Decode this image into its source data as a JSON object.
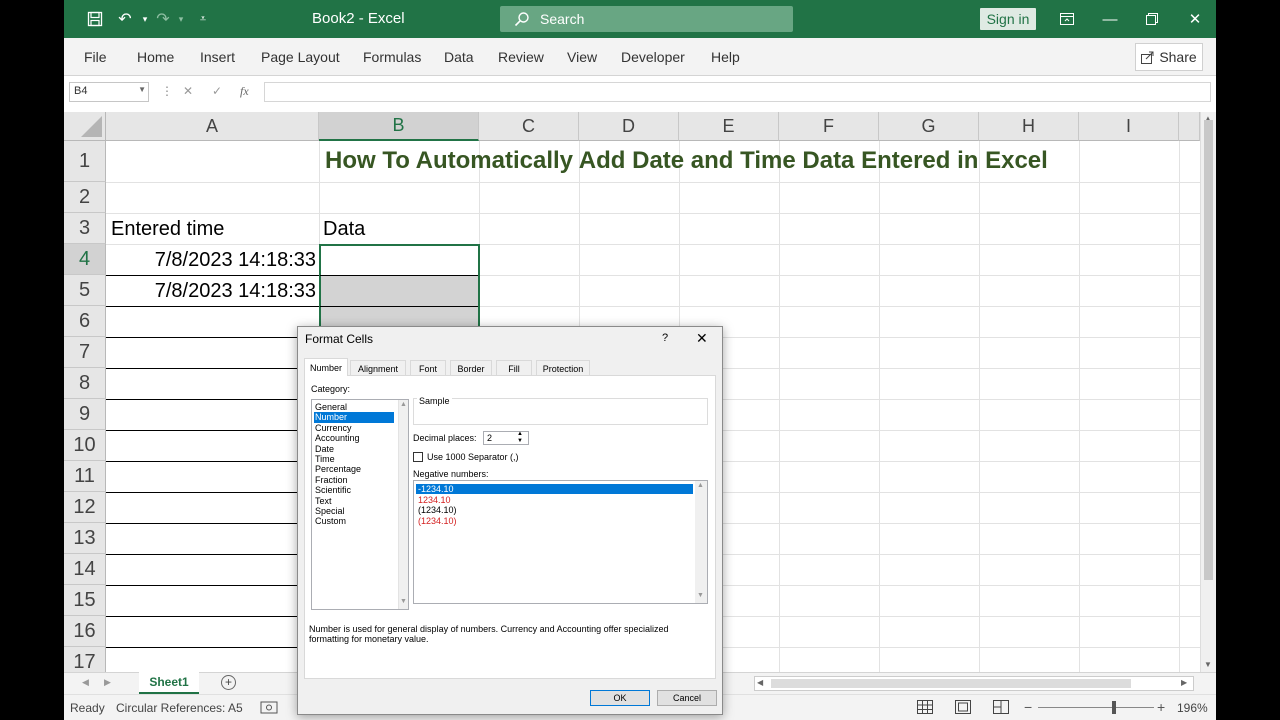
{
  "window": {
    "title": "Book2  -  Excel",
    "search_placeholder": "Search",
    "signin_label": "Sign in"
  },
  "ribbon": {
    "tabs": [
      "File",
      "Home",
      "Insert",
      "Page Layout",
      "Formulas",
      "Data",
      "Review",
      "View",
      "Developer",
      "Help"
    ],
    "share_label": "Share"
  },
  "formula_bar": {
    "name_box": "B4",
    "fx_label": "fx",
    "formula": ""
  },
  "grid": {
    "columns": [
      "A",
      "B",
      "C",
      "D",
      "E",
      "F",
      "G",
      "H",
      "I"
    ],
    "rows": [
      "1",
      "2",
      "3",
      "4",
      "5",
      "6",
      "7",
      "8",
      "9",
      "10",
      "11",
      "12",
      "13",
      "14",
      "15",
      "16",
      "17"
    ],
    "title_text": "How To Automatically Add Date and Time Data Entered in Excel",
    "title_color": "#375623",
    "header_a": "Entered time",
    "header_b": "Data",
    "a4": "7/8/2023 14:18:33",
    "a5": "7/8/2023 14:18:33"
  },
  "sheets": {
    "tabs": [
      "Sheet1"
    ],
    "active": "Sheet1"
  },
  "status": {
    "ready": "Ready",
    "circular": "Circular References: A5",
    "zoom": "196%"
  },
  "dialog": {
    "title": "Format Cells",
    "help": "?",
    "tabs": [
      "Number",
      "Alignment",
      "Font",
      "Border",
      "Fill",
      "Protection"
    ],
    "active_tab": "Number",
    "category_label": "Category:",
    "categories": [
      "General",
      "Number",
      "Currency",
      "Accounting",
      "Date",
      "Time",
      "Percentage",
      "Fraction",
      "Scientific",
      "Text",
      "Special",
      "Custom"
    ],
    "selected_category": "Number",
    "sample_label": "Sample",
    "decimal_label": "Decimal places:",
    "decimal_value": "2",
    "separator_label": "Use 1000 Separator (,)",
    "negative_label": "Negative numbers:",
    "negative_options": [
      "-1234.10",
      "1234.10",
      "(1234.10)",
      "(1234.10)"
    ],
    "negative_colors": [
      "#ffffff",
      "#d42020",
      "#000000",
      "#d42020"
    ],
    "description": "Number is used for general display of numbers.  Currency and Accounting offer specialized formatting for monetary value.",
    "ok_label": "OK",
    "cancel_label": "Cancel"
  }
}
